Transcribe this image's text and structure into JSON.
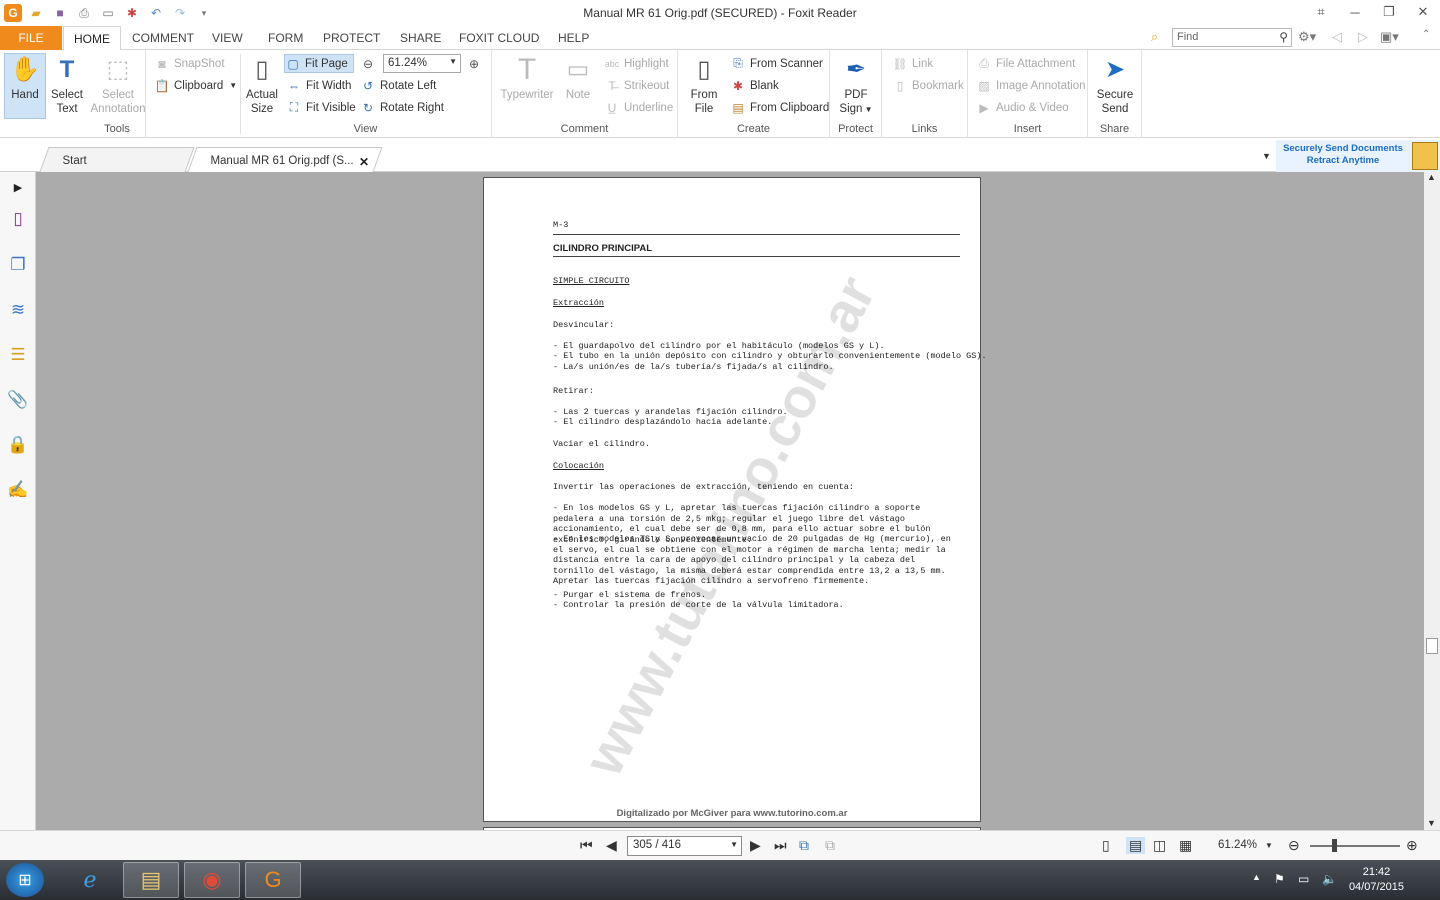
{
  "window": {
    "title": "Manual MR 61 Orig.pdf (SECURED) - Foxit Reader"
  },
  "menu_tabs": [
    "FILE",
    "HOME",
    "COMMENT",
    "VIEW",
    "FORM",
    "PROTECT",
    "SHARE",
    "FOXIT CLOUD",
    "HELP"
  ],
  "search": {
    "placeholder": "Find"
  },
  "ribbon": {
    "tools": {
      "label": "Tools",
      "hand": "Hand",
      "select_text_1": "Select",
      "select_text_2": "Text",
      "select_annotation_1": "Select",
      "select_annotation_2": "Annotation",
      "snapshot": "SnapShot",
      "clipboard": "Clipboard"
    },
    "view": {
      "label": "View",
      "actual_size_1": "Actual",
      "actual_size_2": "Size",
      "fit_page": "Fit Page",
      "fit_width": "Fit Width",
      "fit_visible": "Fit Visible",
      "zoom": "61.24%",
      "rotate_left": "Rotate Left",
      "rotate_right": "Rotate Right"
    },
    "comment": {
      "label": "Comment",
      "typewriter": "Typewriter",
      "note": "Note",
      "highlight": "Highlight",
      "strikeout": "Strikeout",
      "underline": "Underline"
    },
    "create": {
      "label": "Create",
      "from_file_1": "From",
      "from_file_2": "File",
      "from_scanner": "From Scanner",
      "blank": "Blank",
      "from_clipboard": "From Clipboard"
    },
    "protect": {
      "label": "Protect",
      "pdf_sign_1": "PDF",
      "pdf_sign_2": "Sign"
    },
    "links": {
      "label": "Links",
      "link": "Link",
      "bookmark": "Bookmark"
    },
    "insert": {
      "label": "Insert",
      "file_attachment": "File Attachment",
      "image_annotation": "Image Annotation",
      "audio_video": "Audio & Video"
    },
    "share": {
      "label": "Share",
      "secure_send_1": "Secure",
      "secure_send_2": "Send"
    }
  },
  "doc_tabs": {
    "start": "Start",
    "document": "Manual MR 61 Orig.pdf (S..."
  },
  "promo": {
    "line1": "Securely Send Documents",
    "line2": "Retract Anytime"
  },
  "page_content": {
    "code": "M-3",
    "heading": "CILINDRO PRINCIPAL",
    "subheading": "SIMPLE CIRCUITO",
    "extraction_title": "Extracción",
    "desvincular": "Desvincular:",
    "d1": "- El guardapolvo del cilindro por el habitáculo (modelos GS y L).",
    "d2": "- El tubo en la unión depósito con cilindro y obturarlo convenientemente (modelo GS).",
    "d3": "- La/s unión/es de la/s tubería/s fijada/s al cilindro.",
    "retirar": "Retirar:",
    "r1": "- Las 2 tuercas y arandelas fijación cilindro.",
    "r2": "- El cilindro desplazándolo hacia adelante.",
    "vaciar": "Vaciar el cilindro.",
    "colocacion_title": "Colocación",
    "invertir": "Invertir las operaciones de extracción, teniendo en cuenta:",
    "c1": "- En los modelos GS y L, apretar las tuercas fijación cilindro a soporte pedalera a una torsión de 2,5 mkg; regular el juego libre del vástago accionamiento, el cual debe ser de 0,8 mm, para ello actuar sobre el bulón excéntrico, girándolo convenientemente.",
    "c2": "- En los modelos TS y S, provocar un vacío de 20 pulgadas de Hg (mercurio), en el servo, el cual se obtiene con el motor a régimen de marcha lenta; medir la distancia entre la cara de apoyo del cilindro principal y la cabeza del tornillo del vástago, la misma deberá estar comprendida entre 13,2 a 13,5 mm. Apretar las tuercas fijación cilindro a servofreno firmemente.",
    "c3": "- Purgar el sistema de frenos.",
    "c4": "- Controlar la presión de corte de la válvula limitadora.",
    "watermark": "www.tutorino.com.ar",
    "footer": "Digitalizado por McGiver para www.tutorino.com.ar"
  },
  "status": {
    "page": "305 / 416",
    "zoom": "61.24%"
  },
  "taskbar": {
    "time": "21:42",
    "date": "04/07/2015"
  }
}
